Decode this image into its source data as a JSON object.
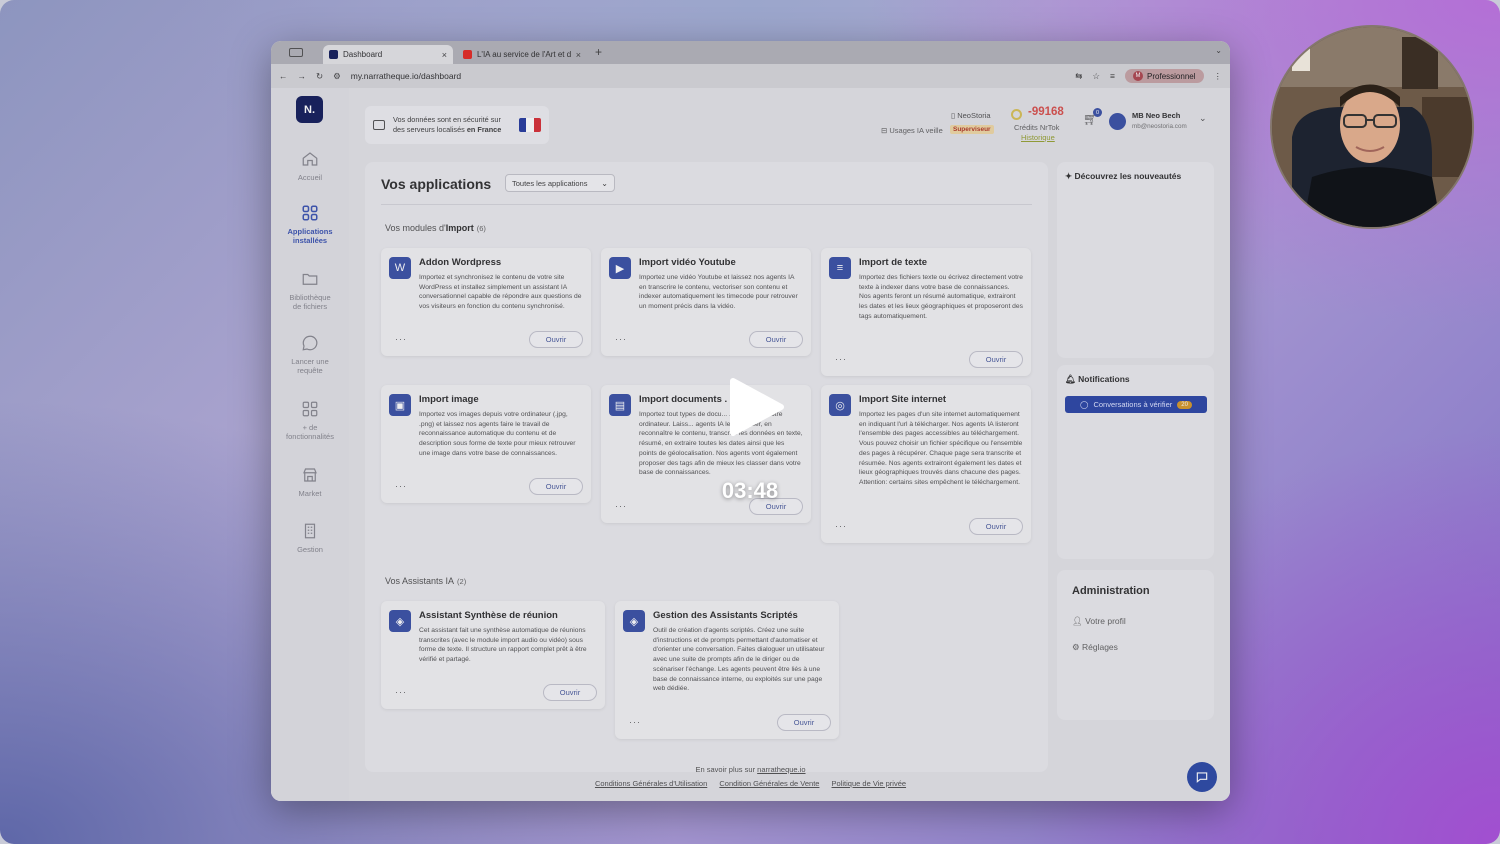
{
  "browser": {
    "tabs": [
      {
        "label": "Dashboard"
      },
      {
        "label": "L'IA au service de l'Art et de"
      }
    ],
    "url": "my.narratheque.io/dashboard",
    "profile": "Professionnel",
    "profile_initial": "M"
  },
  "sidebar": {
    "logo": "N.",
    "items": [
      {
        "label": "Accueil",
        "icon": "home-icon",
        "active": false
      },
      {
        "label": "Applications installées",
        "icon": "apps-grid-icon",
        "active": true
      },
      {
        "label": "Bibliothèque de fichiers",
        "icon": "folder-icon",
        "active": false
      },
      {
        "label": "Lancer une requête",
        "icon": "chat-bubble-icon",
        "active": false
      },
      {
        "label": "+ de fonctionnalités",
        "icon": "more-features-icon",
        "active": false
      },
      {
        "label": "Market",
        "icon": "market-icon",
        "active": false
      },
      {
        "label": "Gestion",
        "icon": "building-icon",
        "active": false
      }
    ]
  },
  "banner": {
    "text": "Vos données sont en sécurité sur des serveurs localisés",
    "text_bold": "en France"
  },
  "header": {
    "org": "NeoStoria",
    "usage": "Usages IA veille",
    "role_badge": "Superviseur",
    "credits_value": "-99168",
    "credits_label": "Crédits NrTok",
    "history_link": "Historique",
    "cart_badge": "0",
    "user_name": "MB Neo Bech",
    "user_email": "mb@neostoria.com"
  },
  "main": {
    "title": "Vos applications",
    "filter_value": "Toutes les applications",
    "import_section": {
      "prefix": "Vos modules d'",
      "bold": "Import",
      "count": "(6)"
    },
    "assistant_section": {
      "label": "Vos Assistants IA",
      "count": "(2)"
    },
    "open_label": "Ouvrir",
    "import_cards": [
      {
        "title": "Addon Wordpress",
        "icon": "wordpress-icon",
        "desc": "Importez et synchronisez le contenu de votre site WordPress et installez simplement un assistant IA conversationnel capable de répondre aux questions de vos visiteurs en fonction du contenu synchronisé."
      },
      {
        "title": "Import vidéo Youtube",
        "icon": "youtube-icon",
        "desc": "Importez une vidéo Youtube et laissez nos agents IA en transcrire le contenu, vectoriser son contenu et indexer automatiquement les timecode pour retrouver un moment précis dans la vidéo."
      },
      {
        "title": "Import de texte",
        "icon": "text-doc-icon",
        "desc": "Importez des fichiers texte ou écrivez directement votre texte à indexer dans votre base de connaissances. Nos agents feront un résumé automatique, extrairont les dates et les lieux géographiques et proposeront des tags automatiquement."
      },
      {
        "title": "Import image",
        "icon": "image-icon",
        "desc": "Importez vos images depuis votre ordinateur (.jpg, .png) et laissez nos agents faire le travail de reconnaissance automatique du contenu et de description sous forme de texte pour mieux retrouver une image dans votre base de connaissances."
      },
      {
        "title": "Import documents .",
        "icon": "document-icon",
        "desc": "Importez tout types de docu... .PDF depuis votre ordinateur. Laiss... agents IA les analyser, en reconnaître le contenu, transcrire les données en texte, résumé, en extraire toutes les dates ainsi que les points de géolocalisation. Nos agents vont également proposer des tags afin de mieux les classer dans votre base de connaissances."
      },
      {
        "title": "Import Site internet",
        "icon": "globe-icon",
        "desc": "Importez les pages d'un site internet automatiquement en indiquant l'url à télécharger. Nos agents IA listeront l'ensemble des pages accessibles au téléchargement. Vous pouvez choisir un fichier spécifique ou l'ensemble des pages à récupérer. Chaque page sera transcrite et résumée. Nos agents extrairont également les dates et lieux géographiques trouvés dans chacune des pages. Attention: certains sites empêchent le téléchargement."
      }
    ],
    "assistant_cards": [
      {
        "title": "Assistant Synthèse de réunion",
        "icon": "assistant-icon",
        "desc": "Cet assistant fait une synthèse automatique de réunions transcrites (avec le module import audio ou vidéo) sous forme de texte. Il structure un rapport complet prêt à être vérifié et partagé."
      },
      {
        "title": "Gestion des Assistants Scriptés",
        "icon": "script-icon",
        "desc": "Outil de création d'agents scriptés. Créez une suite d'instructions et de prompts permettant d'automatiser et d'orienter une conversation. Faites dialoguer un utilisateur avec une suite de prompts afin de le diriger ou de scénariser l'échange. Les agents peuvent être liés à une base de connaissance interne, ou exploités sur une page web dédiée."
      }
    ]
  },
  "right": {
    "news_title": "Découvrez les nouveautés",
    "notifications_title": "Notifications",
    "conversations_btn": "Conversations à vérifier",
    "conversations_badge": "20",
    "admin_title": "Administration",
    "admin_items": [
      "Votre profil",
      "Réglages"
    ]
  },
  "footer": {
    "learn_more": "En savoir plus sur",
    "learn_more_link": "narratheque.io",
    "links": [
      "Conditions Générales d'Utilisation",
      "Condition Générales de Vente",
      "Politique de Vie privée"
    ]
  },
  "video": {
    "timestamp": "03:48"
  },
  "colors": {
    "accent": "#3d54a8",
    "logo_bg": "#17215e",
    "credits_negative": "#d9534f",
    "badge_orange": "#d79b2d"
  }
}
